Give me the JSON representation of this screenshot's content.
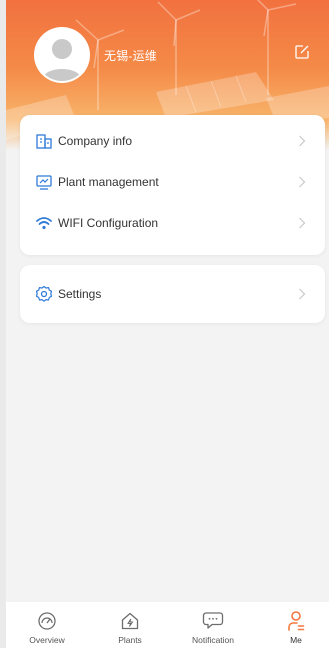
{
  "colors": {
    "accent": "#f4783f",
    "icon_blue": "#2f7bd8",
    "tab_inactive": "#777777"
  },
  "profile": {
    "username": "无锡-运维",
    "avatar_icon": "user-avatar-icon",
    "edit_icon": "edit-icon"
  },
  "menu": {
    "group1": [
      {
        "label": "Company info",
        "icon": "building-icon"
      },
      {
        "label": "Plant management",
        "icon": "monitor-chart-icon"
      },
      {
        "label": "WIFI Configuration",
        "icon": "wifi-icon"
      }
    ],
    "group2": [
      {
        "label": "Settings",
        "icon": "gear-icon"
      }
    ]
  },
  "tabbar": {
    "items": [
      {
        "label": "Overview",
        "icon": "dashboard-gauge-icon",
        "active": false
      },
      {
        "label": "Plants",
        "icon": "house-lightning-icon",
        "active": false
      },
      {
        "label": "Notification",
        "icon": "chat-bubble-icon",
        "active": false
      },
      {
        "label": "Me",
        "icon": "person-icon",
        "active": true
      }
    ]
  }
}
